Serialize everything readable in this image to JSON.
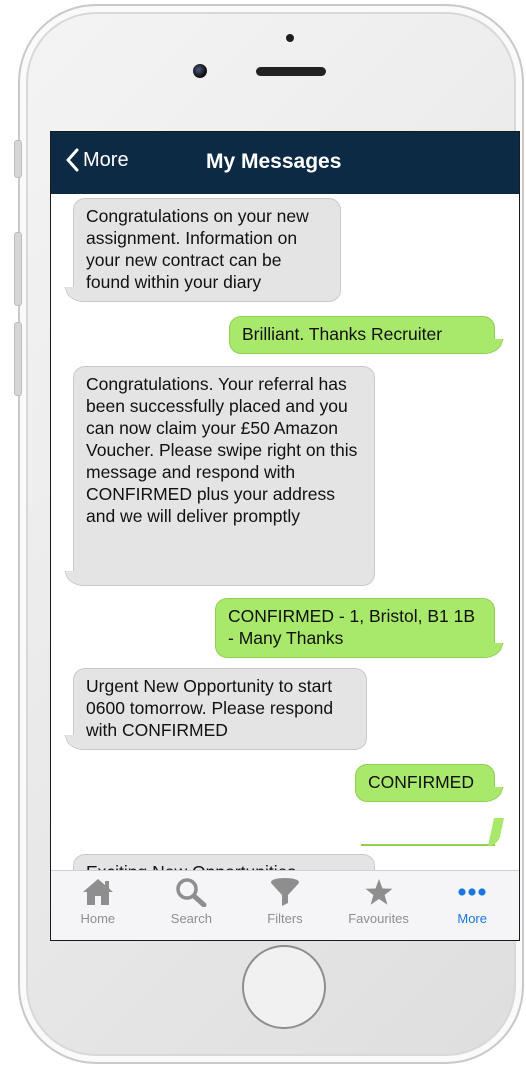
{
  "navbar": {
    "back_label": "More",
    "title": "My Messages"
  },
  "messages": [
    {
      "direction": "incoming",
      "text": "Congratulations on your new assignment. Information on your new contract can be found within your diary"
    },
    {
      "direction": "outgoing",
      "text": "Brilliant. Thanks Recruiter"
    },
    {
      "direction": "incoming",
      "text": "Congratulations. Your referral has been successfully placed and you can now claim your £50 Amazon Voucher. Please swipe right on this message and respond with CONFIRMED plus your address and we will deliver promptly"
    },
    {
      "direction": "outgoing",
      "text": "CONFIRMED - 1, Bristol, B1 1B - Many Thanks"
    },
    {
      "direction": "incoming",
      "text": "Urgent New Opportunity to start 0600 tomorrow. Please respond with CONFIRMED"
    },
    {
      "direction": "outgoing",
      "text": "CONFIRMED"
    },
    {
      "direction": "outgoing",
      "text": ""
    },
    {
      "direction": "incoming",
      "text": "Exciting New Opportunities"
    }
  ],
  "tabbar": {
    "tabs": [
      {
        "label": "Home",
        "icon": "home-icon",
        "active": false
      },
      {
        "label": "Search",
        "icon": "search-icon",
        "active": false
      },
      {
        "label": "Filters",
        "icon": "funnel-icon",
        "active": false
      },
      {
        "label": "Favourites",
        "icon": "star-icon",
        "active": false
      },
      {
        "label": "More",
        "icon": "more-dots-icon",
        "active": true
      }
    ]
  },
  "colors": {
    "navbar": "#0d2a44",
    "incoming_bubble": "#e4e4e4",
    "outgoing_bubble": "#a8e86b",
    "active_tab": "#1876e0",
    "inactive_tab": "#8e8e8e"
  }
}
